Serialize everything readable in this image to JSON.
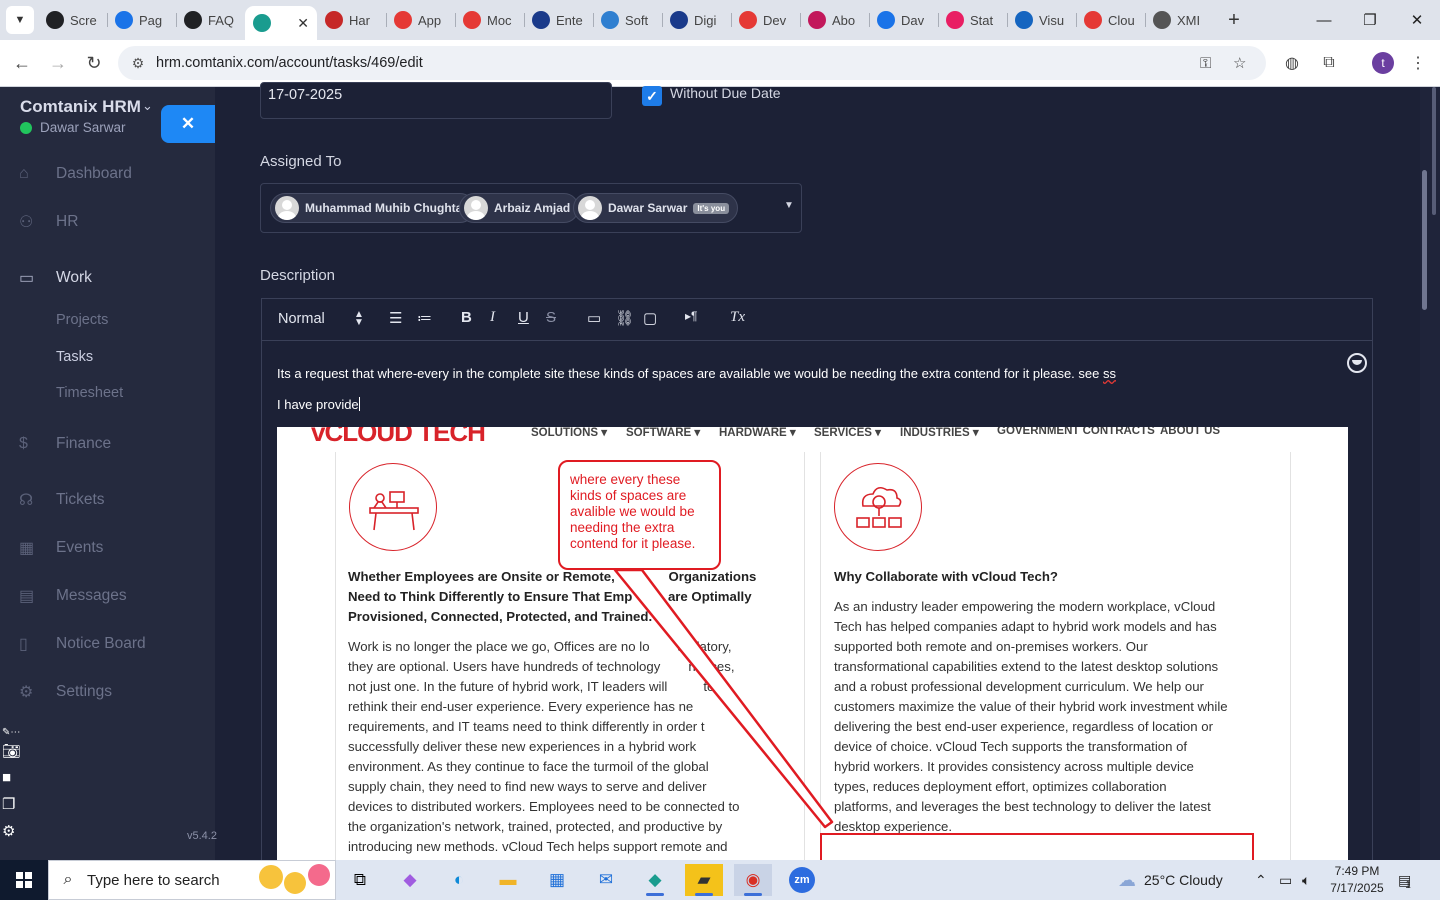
{
  "browser": {
    "tabs": [
      {
        "label": "Scre",
        "icon": "screen-icon",
        "color": "#202124",
        "active": false
      },
      {
        "label": "Pag",
        "icon": "gauge-icon",
        "color": "#1a73e8",
        "active": false
      },
      {
        "label": "FAQ",
        "icon": "openai-icon",
        "color": "#202124",
        "active": false
      },
      {
        "label": "",
        "icon": "comtanix-icon",
        "color": "#1a9c8f",
        "active": true
      },
      {
        "label": "Har",
        "icon": "v-icon",
        "color": "#c62828",
        "active": false
      },
      {
        "label": "App",
        "icon": "diamond-icon",
        "color": "#e53935",
        "active": false
      },
      {
        "label": "Moc",
        "icon": "diamond-icon",
        "color": "#e53935",
        "active": false
      },
      {
        "label": "Ente",
        "icon": "check-icon",
        "color": "#1a3a8a",
        "active": false
      },
      {
        "label": "Soft",
        "icon": "hex-icon",
        "color": "#2f7fd0",
        "active": false
      },
      {
        "label": "Digi",
        "icon": "x-icon",
        "color": "#1a3a8a",
        "active": false
      },
      {
        "label": "Dev",
        "icon": "diamond-icon",
        "color": "#e53935",
        "active": false
      },
      {
        "label": "Abo",
        "icon": "diamond-icon",
        "color": "#c2185b",
        "active": false
      },
      {
        "label": "Dav",
        "icon": "scale-icon",
        "color": "#1a73e8",
        "active": false
      },
      {
        "label": "Stat",
        "icon": "pen-icon",
        "color": "#e91e63",
        "active": false
      },
      {
        "label": "Visu",
        "icon": "wave-icon",
        "color": "#1565c0",
        "active": false
      },
      {
        "label": "Clou",
        "icon": "slash-icon",
        "color": "#e53935",
        "active": false
      },
      {
        "label": "XMI",
        "icon": "globe-icon",
        "color": "#555555",
        "active": false
      }
    ],
    "url": "hrm.comtanix.com/account/tasks/469/edit",
    "profile_initial": "t"
  },
  "sidebar": {
    "brand": "Comtanix HRM",
    "user": "Dawar Sarwar",
    "nav": [
      {
        "label": "Dashboard",
        "icon": "home-icon"
      },
      {
        "label": "HR",
        "icon": "users-icon"
      },
      {
        "label": "Work",
        "icon": "briefcase-icon"
      },
      {
        "label": "Finance",
        "icon": "dollar-icon"
      },
      {
        "label": "Tickets",
        "icon": "headset-icon"
      },
      {
        "label": "Events",
        "icon": "calendar-icon"
      },
      {
        "label": "Messages",
        "icon": "message-icon"
      },
      {
        "label": "Notice Board",
        "icon": "clipboard-icon"
      },
      {
        "label": "Settings",
        "icon": "gear-icon"
      }
    ],
    "work_sub": [
      "Projects",
      "Tasks",
      "Timesheet"
    ],
    "version": "v5.4.2"
  },
  "form": {
    "due_date": "17-07-2025",
    "without_due_date_label": "Without Due Date",
    "assigned_label": "Assigned To",
    "assignees": [
      "Muhammad Muhib Chughtai",
      "Arbaiz Amjad",
      "Dawar Sarwar"
    ],
    "self_badge": "It's you",
    "description_label": "Description",
    "format_select": "Normal",
    "description_line1": "Its a request that where-every in the complete site these kinds of spaces are available we would be needing the extra contend for it please. see",
    "description_line1_end": "ss",
    "description_line2": "I have provide"
  },
  "screenshot": {
    "logo": "vCLOUD TECH",
    "menu": [
      "SOLUTIONS ▾",
      "SOFTWARE ▾",
      "HARDWARE ▾",
      "SERVICES ▾",
      "INDUSTRIES ▾",
      "GOVERNMENT CONTRACTS",
      "ABOUT US"
    ],
    "callout": "where every these kinds of spaces are avalible we would be needing the extra contend for it please.",
    "left_heading": [
      "Whether Employees are Onsite or Remote,",
      "Organizations",
      "Need to Think Differently to Ensure That Emp",
      "are Optimally",
      "Provisioned, Connected, Protected, and Trained."
    ],
    "left_body": [
      "Work is no longer the place we go, Offices are no lo",
      "andatory,",
      "they are optional. Users have hundreds of technology",
      "riences,",
      "not just one.  In the future of hybrid work, IT leaders will",
      "to",
      "rethink their end-user experience. Every experience has ne",
      "requirements, and IT teams need to think differently in order t",
      "successfully deliver these new experiences in a hybrid work",
      "environment. As they continue to face the turmoil of the global",
      "supply chain, they need to find new ways to serve and deliver",
      "devices to distributed workers. Employees need to be connected to",
      "the organization's network, trained, protected, and productive by",
      "introducing new methods. vCloud Tech helps support remote and"
    ],
    "right_heading": "Why Collaborate with vCloud Tech?",
    "right_body": [
      "As an industry leader empowering the modern workplace, vCloud",
      "Tech has helped companies adapt to hybrid work models and has",
      "supported both remote and on-premises workers. Our",
      "transformational capabilities extend to the latest desktop solutions",
      "and a robust professional development curriculum. We help our",
      "customers maximize the value of their hybrid work investment while",
      "delivering the best end-user experience, regardless of location or",
      "device of choice. vCloud Tech supports the transformation of",
      "hybrid workers. It provides consistency across multiple device",
      "types, reduces deployment effort, optimizes collaboration",
      "platforms, and leverages the best technology to deliver the latest",
      "desktop experience."
    ]
  },
  "taskbar": {
    "search_placeholder": "Type here to search",
    "weather": "25°C  Cloudy",
    "time": "7:49 PM",
    "date": "7/17/2025",
    "notifications": "1"
  },
  "colors": {
    "accent": "#1e88f5",
    "sidebar_bg": "#252a3e",
    "content_bg": "#1c2136",
    "brand_red": "#d8232a",
    "online": "#21c55d"
  }
}
